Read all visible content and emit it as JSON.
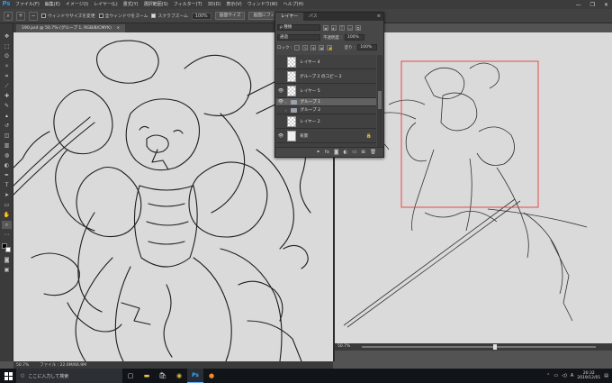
{
  "app": {
    "logo": "Ps",
    "window_controls": [
      "—",
      "❐",
      "✕"
    ]
  },
  "menu": [
    "ファイル(F)",
    "編集(E)",
    "イメージ(I)",
    "レイヤー(L)",
    "書式(Y)",
    "選択範囲(S)",
    "フィルター(T)",
    "3D(D)",
    "表示(V)",
    "ウィンドウ(W)",
    "ヘルプ(H)"
  ],
  "options_bar": {
    "tool_icon": "zoom-icon",
    "zoom_in": "+",
    "zoom_out": "−",
    "resize_windows": {
      "label": "ウィンドウサイズを変更",
      "checked": false
    },
    "zoom_all": {
      "label": "全ウィンドウをズーム",
      "checked": false
    },
    "scrubby_zoom": {
      "label": "スクラブズーム",
      "checked": true
    },
    "zoom_value": "100%",
    "fit_label": "画面サイズ",
    "fill_label": "画面にフィット"
  },
  "document": {
    "tab_title": "190.psd @ 50.7% (グループ 1, RGB/8/CMYK)",
    "close": "×",
    "status_zoom": "50.7%",
    "status_info": "ファイル : 22.6M/66.9M"
  },
  "right_view": {
    "zoom": "50.7%"
  },
  "layers_panel": {
    "tabs": [
      "レイヤー",
      "パス"
    ],
    "active_tab": 0,
    "menu_icon": "≡",
    "filter_label": "ρ 種類",
    "blend_mode": "通過",
    "opacity_label": "不透明度 :",
    "opacity_value": "100%",
    "lock_label": "ロック :",
    "fill_label": "塗り :",
    "fill_value": "100%",
    "layers": [
      {
        "name": "レイヤー 4",
        "visible": false,
        "kind": "layer",
        "selected": false
      },
      {
        "name": "グループ 2 のコピー 2",
        "visible": false,
        "kind": "layer",
        "selected": false
      },
      {
        "name": "レイヤー 5",
        "visible": true,
        "kind": "layer",
        "selected": false
      },
      {
        "name": "グループ 1",
        "visible": true,
        "kind": "group",
        "selected": true
      },
      {
        "name": "グループ 2",
        "visible": false,
        "kind": "group",
        "selected": false
      },
      {
        "name": "レイヤー 2",
        "visible": false,
        "kind": "layer",
        "selected": false
      },
      {
        "name": "背景",
        "visible": true,
        "kind": "background",
        "selected": false
      }
    ],
    "footer_icons": [
      "link-icon",
      "fx-icon",
      "mask-icon",
      "adjustment-icon",
      "folder-icon",
      "new-layer-icon",
      "trash-icon"
    ],
    "footer_glyphs": [
      "⚭",
      "fx",
      "◙",
      "◐",
      "▭",
      "⊞",
      "🗑"
    ]
  },
  "taskbar": {
    "search_placeholder": "ここに入力して検索",
    "apps": [
      "task-view-icon",
      "explorer-icon",
      "store-icon",
      "chrome-icon",
      "photoshop-icon",
      "app-icon"
    ],
    "time": "20:32",
    "date": "2019/12/01"
  },
  "colors": {
    "ps_blue": "#31a8ff",
    "selection_red": "#e53935",
    "canvas": "#dadada",
    "panel": "#474747"
  }
}
